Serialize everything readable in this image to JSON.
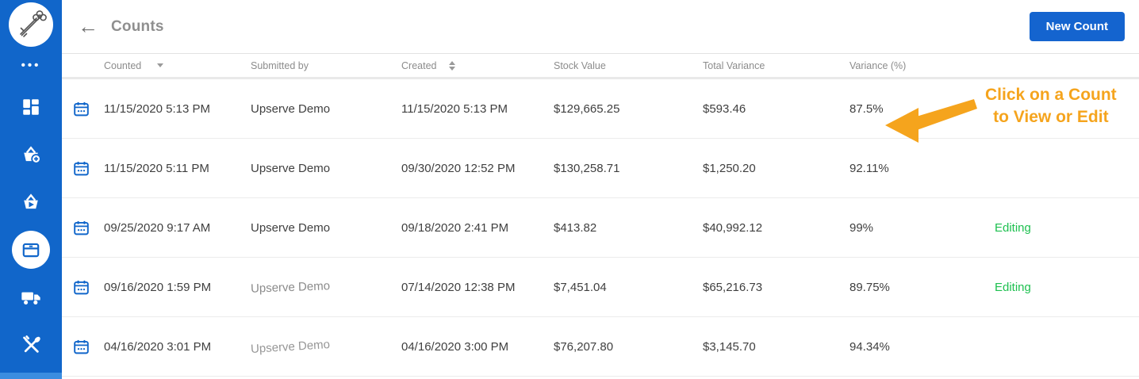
{
  "colors": {
    "sidebar_blue": "#1166ca",
    "button_blue": "#1464cf",
    "accent_green": "#1ec050",
    "annotation_orange": "#f5a41d"
  },
  "icons": {
    "back_arrow": "←",
    "ellipsis": "•••"
  },
  "header": {
    "title": "Counts",
    "new_count_button": "New Count"
  },
  "sidebar": {
    "active_item": "inventory",
    "items": [
      {
        "name": "more-menu",
        "icon": "ellipsis-icon"
      },
      {
        "name": "dashboard",
        "icon": "dashboard-icon"
      },
      {
        "name": "purchasing-add",
        "icon": "basket-plus-icon"
      },
      {
        "name": "purchasing-send",
        "icon": "basket-send-icon"
      },
      {
        "name": "inventory",
        "icon": "box-icon"
      },
      {
        "name": "deliveries",
        "icon": "truck-icon"
      },
      {
        "name": "menu-items",
        "icon": "utensils-icon"
      }
    ]
  },
  "table": {
    "columns": {
      "counted": "Counted",
      "submitted_by": "Submitted by",
      "created": "Created",
      "stock_value": "Stock Value",
      "total_variance": "Total Variance",
      "variance_pct": "Variance (%)"
    },
    "rows": [
      {
        "counted": "11/15/2020 5:13 PM",
        "submitted_by": "Upserve Demo",
        "created": "11/15/2020 5:13 PM",
        "stock_value": "$129,665.25",
        "total_variance": "$593.46",
        "variance_pct": "87.5%",
        "status": ""
      },
      {
        "counted": "11/15/2020 5:11 PM",
        "submitted_by": "Upserve Demo",
        "created": "09/30/2020 12:52 PM",
        "stock_value": "$130,258.71",
        "total_variance": "$1,250.20",
        "variance_pct": "92.11%",
        "status": ""
      },
      {
        "counted": "09/25/2020 9:17 AM",
        "submitted_by": "Upserve Demo",
        "created": "09/18/2020 2:41 PM",
        "stock_value": "$413.82",
        "total_variance": "$40,992.12",
        "variance_pct": "99%",
        "status": "Editing"
      },
      {
        "counted": "09/16/2020 1:59 PM",
        "submitted_by": "Upserve Demo",
        "created": "07/14/2020 12:38 PM",
        "stock_value": "$7,451.04",
        "total_variance": "$65,216.73",
        "variance_pct": "89.75%",
        "status": "Editing"
      },
      {
        "counted": "04/16/2020 3:01 PM",
        "submitted_by": "Upserve Demo",
        "created": "04/16/2020 3:00 PM",
        "stock_value": "$76,207.80",
        "total_variance": "$3,145.70",
        "variance_pct": "94.34%",
        "status": ""
      }
    ]
  },
  "annotation": {
    "line1": "Click on a Count",
    "line2": "to View or Edit"
  }
}
